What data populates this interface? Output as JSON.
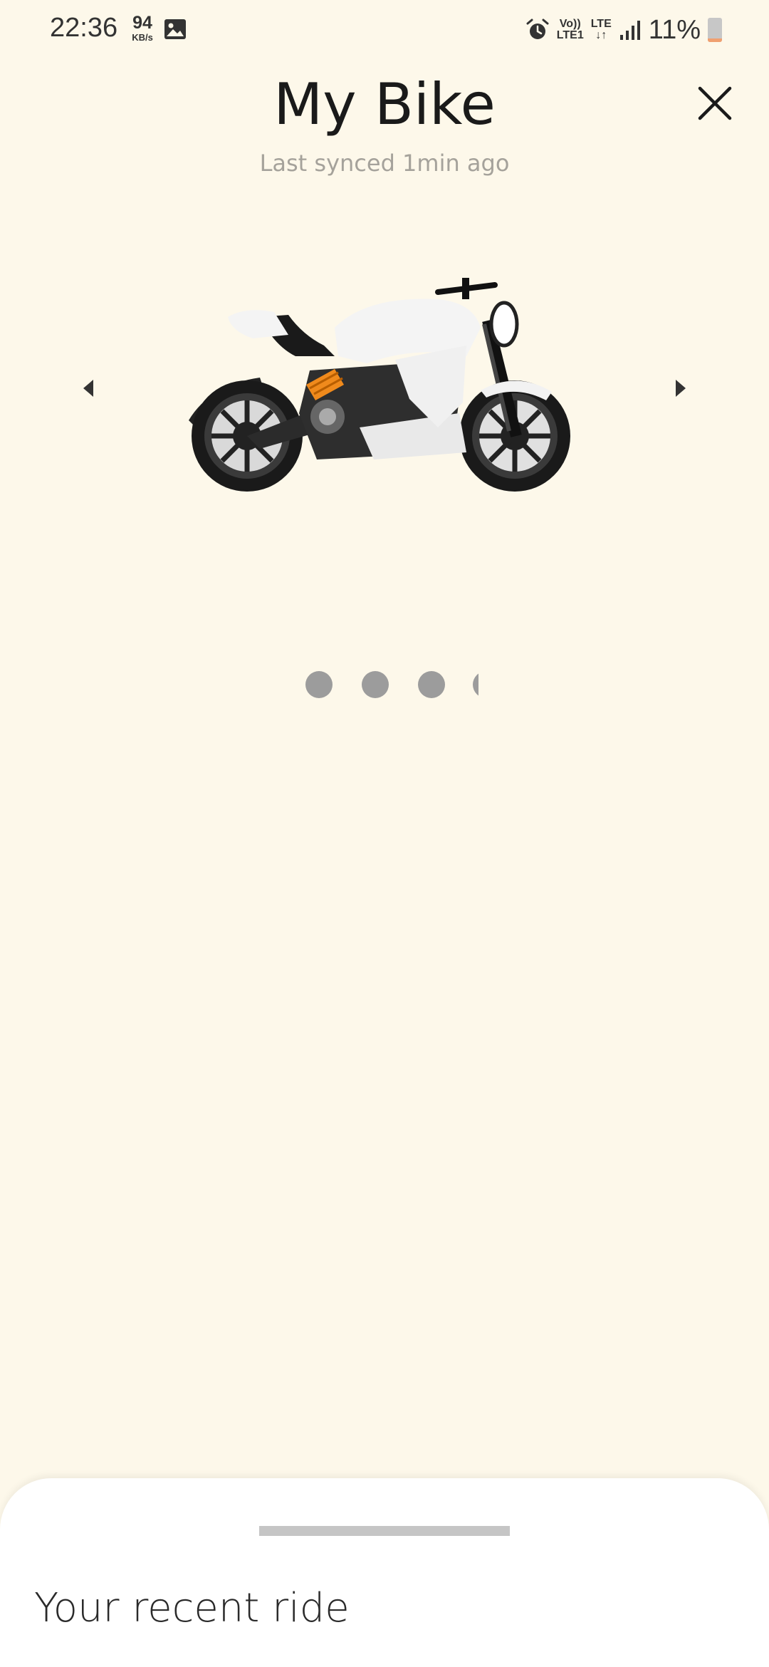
{
  "status_bar": {
    "time": "22:36",
    "net_speed_value": "94",
    "net_speed_unit": "KB/s",
    "volte_top": "Vo))",
    "volte_bottom": "LTE1",
    "lte_label": "LTE",
    "battery_text": "11%",
    "icons": [
      "gallery-icon",
      "alarm-icon",
      "signal-icon",
      "battery-icon"
    ]
  },
  "header": {
    "title": "My Bike",
    "subtitle": "Last synced 1min ago",
    "close_icon": "close-icon"
  },
  "carousel": {
    "image": "electric-motorcycle",
    "prev_icon": "chevron-left-icon",
    "next_icon": "chevron-right-icon",
    "page_indicators": 4,
    "active_index": 0
  },
  "sheet": {
    "title": "Your recent ride"
  },
  "colors": {
    "background": "#fdf8ea",
    "sheet": "#ffffff",
    "dot": "#9c9c9c",
    "subtitle": "#a5a29b",
    "shock_accent": "#f08a1c"
  }
}
